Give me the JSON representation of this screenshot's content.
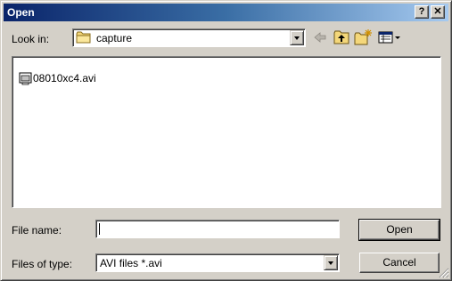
{
  "window": {
    "title": "Open"
  },
  "titlebar": {
    "help_label": "?",
    "close_label": "✕"
  },
  "lookin": {
    "label": "Look in:",
    "value": "capture",
    "icon": "folder-icon"
  },
  "toolbar": {
    "icons": [
      "back-arrow-icon",
      "up-one-level-icon",
      "new-folder-icon",
      "view-menu-icon"
    ]
  },
  "files": [
    {
      "name": "08010xc4.avi",
      "icon": "avi-video-file-icon"
    }
  ],
  "filename": {
    "label": "File name:",
    "value": ""
  },
  "filetype": {
    "label": "Files of type:",
    "value": "AVI files *.avi"
  },
  "buttons": {
    "open": "Open",
    "cancel": "Cancel"
  },
  "colors": {
    "title_start": "#0a246a",
    "title_end": "#a6caf0",
    "face": "#d4d0c8"
  }
}
